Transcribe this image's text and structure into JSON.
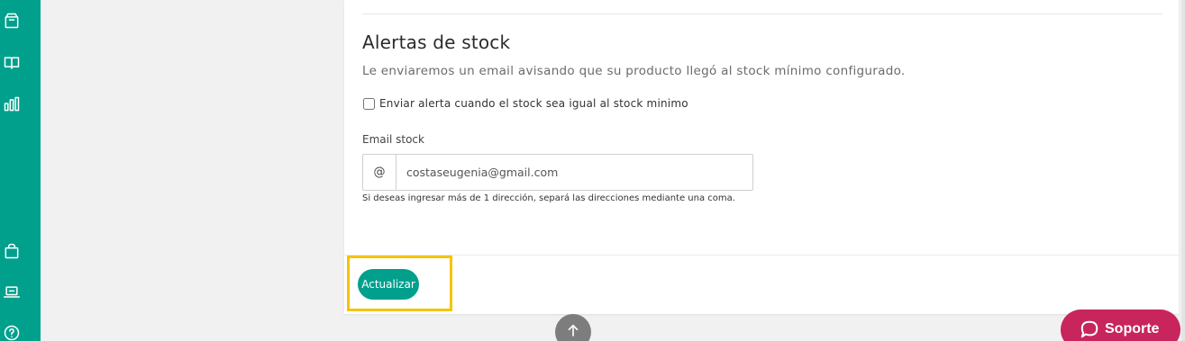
{
  "sidebar": {
    "icons": [
      "box-icon",
      "book-open-icon",
      "bar-chart-icon",
      "shopping-bag-icon",
      "laptop-icon",
      "help-circle-icon"
    ]
  },
  "stock_alert": {
    "title": "Alertas de stock",
    "description": "Le enviaremos un email avisando que su producto llegó al stock mínimo configurado.",
    "checkbox_label": "Enviar alerta cuando el stock sea igual al stock minimo",
    "checkbox_checked": false,
    "email_label": "Email stock",
    "email_prefix": "@",
    "email_value": "costaseugenia@gmail.com",
    "help_text": "Si deseas ingresar más de 1 dirección, separá las direcciones mediante una coma."
  },
  "actions": {
    "update_label": "Actualizar"
  },
  "support": {
    "label": "Soporte"
  },
  "colors": {
    "brand": "#00a08d",
    "highlight": "#f5c400",
    "support": "#c8255d"
  }
}
